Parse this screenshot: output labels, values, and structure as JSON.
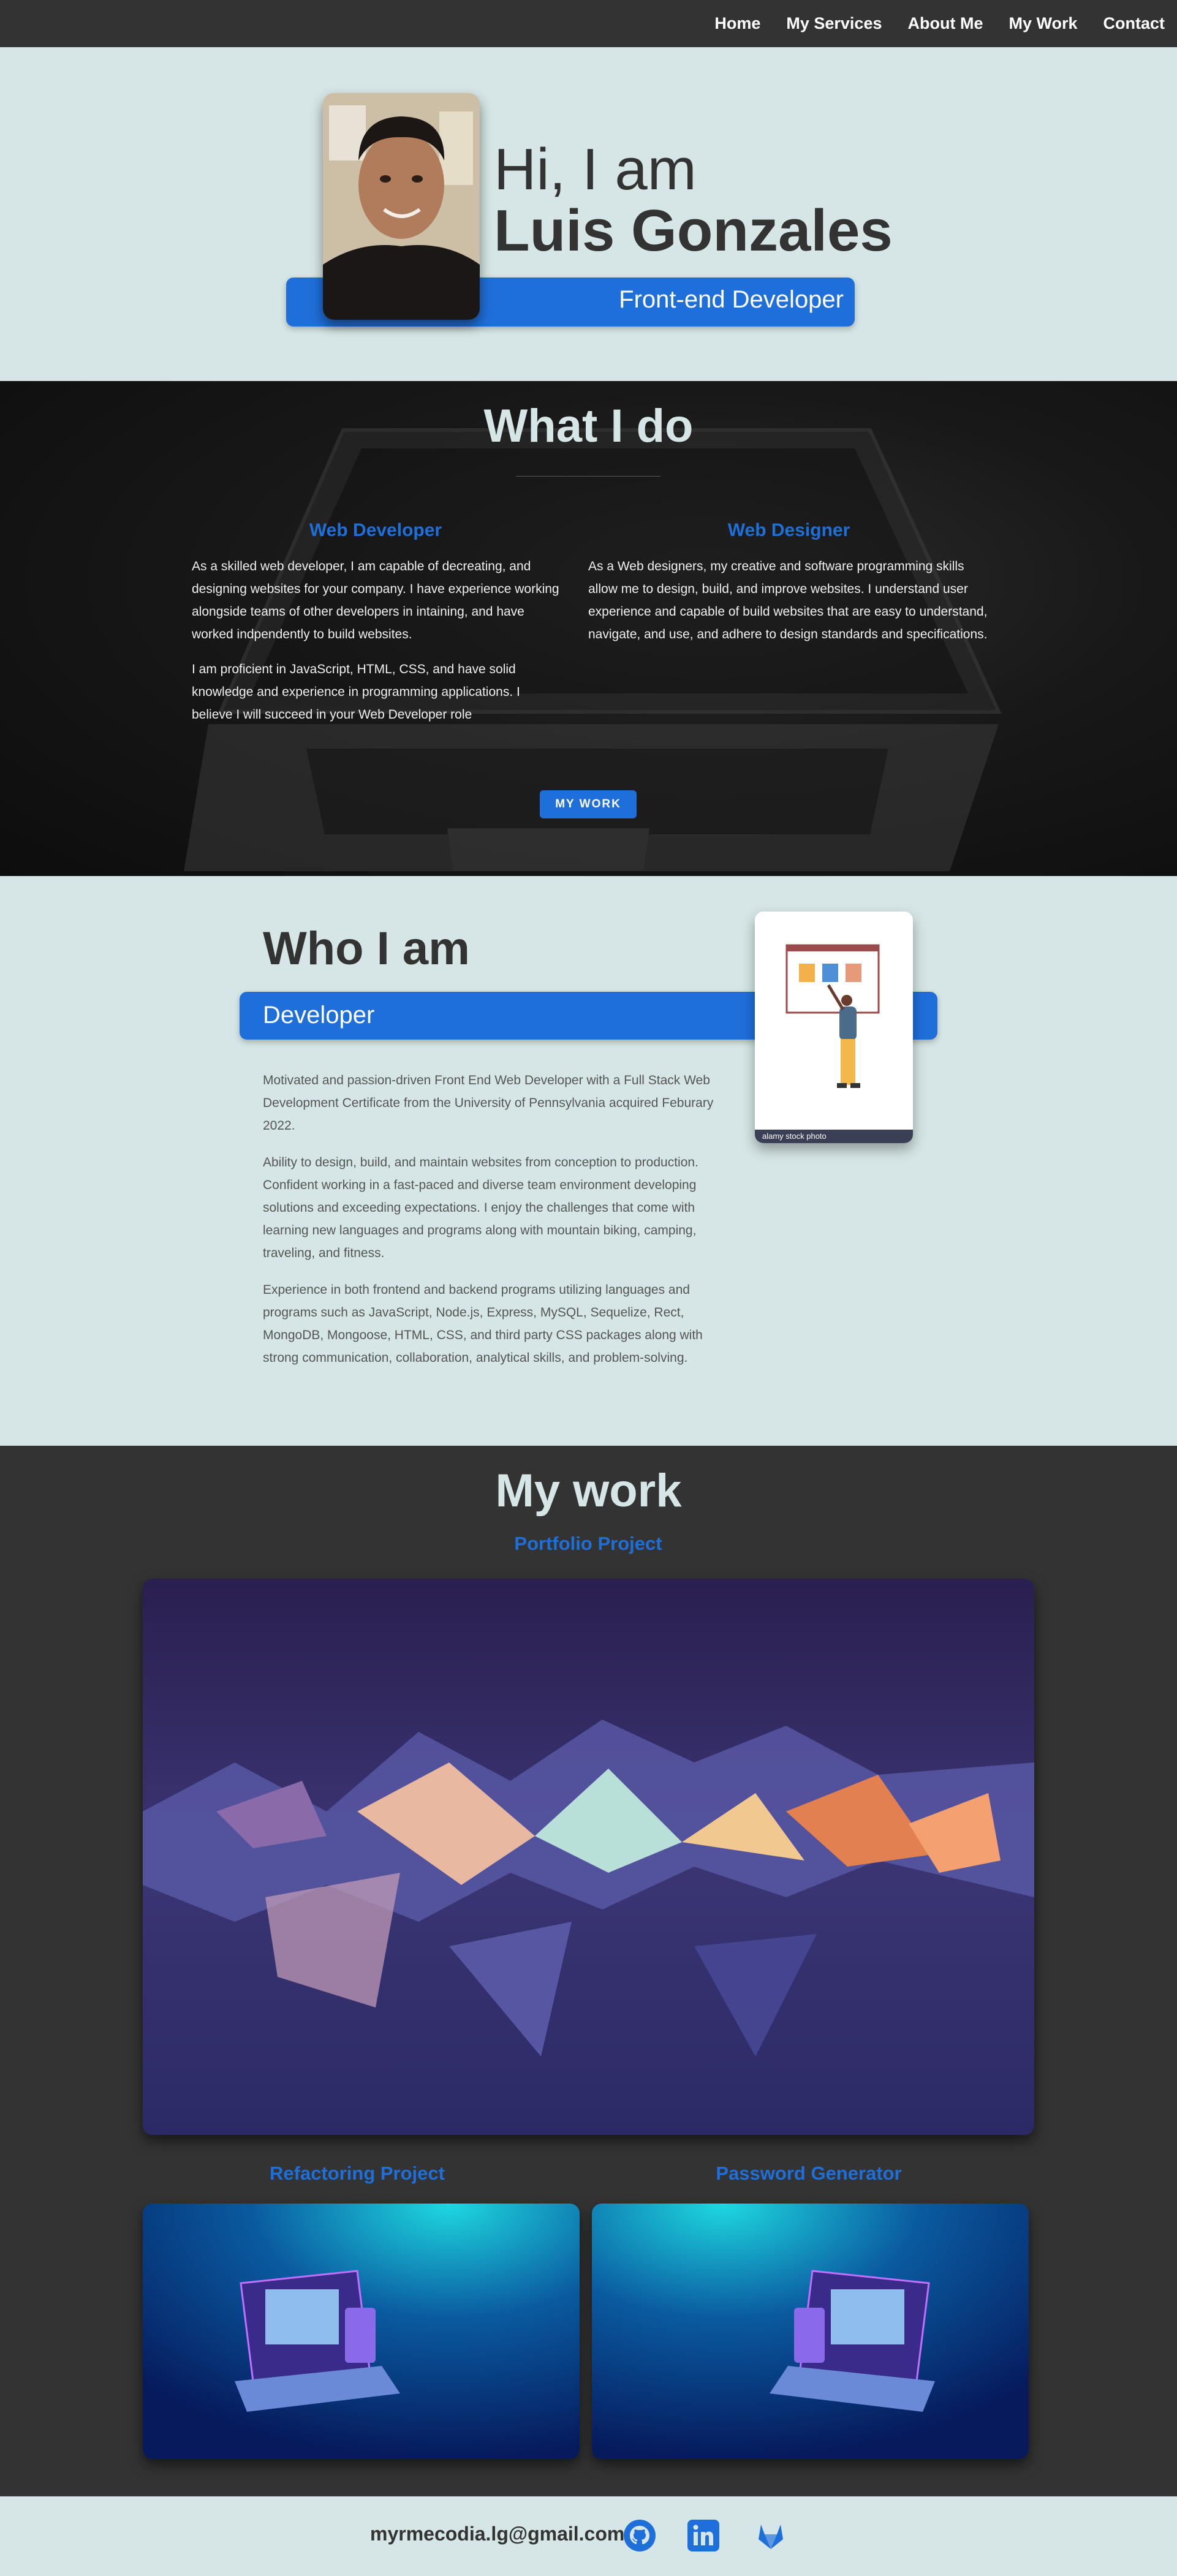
{
  "nav": {
    "items": [
      {
        "label": "Home"
      },
      {
        "label": "My Services"
      },
      {
        "label": "About Me"
      },
      {
        "label": "My Work"
      },
      {
        "label": "Contact"
      }
    ]
  },
  "hero": {
    "greeting": "Hi, I am",
    "name": "Luis Gonzales",
    "role": "Front-end Developer"
  },
  "services": {
    "title": "What I do",
    "columns": [
      {
        "heading": "Web Developer",
        "paragraphs": [
          "As a skilled web developer, I am capable of decreating, and designing websites for your company. I have experience working alongside teams of other developers in intaining, and have worked indpendently to build websites.",
          "I am proficient in JavaScript, HTML, CSS, and have solid knowledge and experience in programming applications. I believe I will succeed in your Web Developer role"
        ]
      },
      {
        "heading": "Web Designer",
        "paragraphs": [
          "As a Web designers, my creative and software programming skills allow me to design, build, and improve websites. I understand user experience and capable of build websites that are easy to understand, navigate, and use, and adhere to design standards and specifications."
        ]
      }
    ],
    "button": "MY WORK"
  },
  "about": {
    "title": "Who I am",
    "role": "Developer",
    "paragraphs": [
      "Motivated and passion-driven Front End Web Developer with a Full Stack Web Development Certificate from the University of Pennsylvania acquired Feburary 2022.",
      "Ability to design, build, and maintain websites from conception to production. Confident working in a fast-paced and diverse team environment developing solutions and exceeding expectations. I enjoy the challenges that come with learning new languages and programs along with mountain biking, camping, traveling, and fitness.",
      "Experience in both frontend and backend programs utilizing languages and programs such as JavaScript, Node.js, Express, MySQL, Sequelize, Rect, MongoDB, Mongoose, HTML, CSS, and third party CSS packages along with strong communication, collaboration, analytical skills, and problem-solving."
    ],
    "image_caption": "alamy stock photo"
  },
  "work": {
    "title": "My work",
    "projects": [
      {
        "title": "Portfolio Project"
      },
      {
        "title": "Refactoring Project"
      },
      {
        "title": "Password Generator"
      }
    ]
  },
  "footer": {
    "email": "myrmecodia.lg@gmail.com",
    "icons": [
      "github-icon",
      "linkedin-icon",
      "gitlab-icon"
    ]
  },
  "colors": {
    "accent": "#1f6fdb",
    "dark": "#333333",
    "light": "#d6e6e6"
  }
}
